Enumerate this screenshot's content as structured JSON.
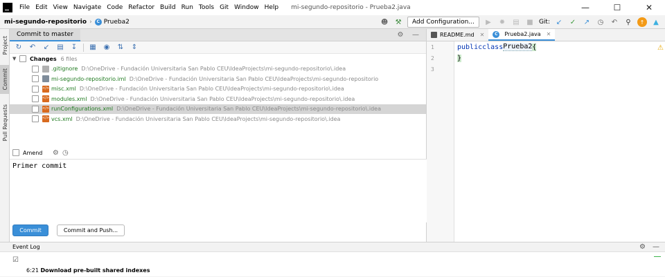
{
  "menu": [
    "File",
    "Edit",
    "View",
    "Navigate",
    "Code",
    "Refactor",
    "Build",
    "Run",
    "Tools",
    "Git",
    "Window",
    "Help"
  ],
  "window_title": "mi-segundo-repositorio - Prueba2.java",
  "window_controls": [
    "—",
    "☐",
    "✕"
  ],
  "navbar": {
    "project": "mi-segundo-repositorio",
    "file": "Prueba2",
    "add_config": "Add Configuration...",
    "git_label": "Git:"
  },
  "left_stripe": [
    "Project",
    "Commit",
    "Pull Requests"
  ],
  "commit_panel": {
    "tab": "Commit to master",
    "changes_label": "Changes",
    "changes_count": "6 files",
    "files": [
      {
        "name": ".gitignore",
        "path": "D:\\OneDrive - Fundación Universitaria San Pablo CEU\\IdeaProjects\\mi-segundo-repositorio\\.idea",
        "type": "git",
        "selected": false
      },
      {
        "name": "mi-segundo-repositorio.iml",
        "path": "D:\\OneDrive - Fundación Universitaria San Pablo CEU\\IdeaProjects\\mi-segundo-repositorio",
        "type": "iml",
        "selected": false
      },
      {
        "name": "misc.xml",
        "path": "D:\\OneDrive - Fundación Universitaria San Pablo CEU\\IdeaProjects\\mi-segundo-repositorio\\.idea",
        "type": "xml",
        "selected": false
      },
      {
        "name": "modules.xml",
        "path": "D:\\OneDrive - Fundación Universitaria San Pablo CEU\\IdeaProjects\\mi-segundo-repositorio\\.idea",
        "type": "xml",
        "selected": false
      },
      {
        "name": "runConfigurations.xml",
        "path": "D:\\OneDrive - Fundación Universitaria San Pablo CEU\\IdeaProjects\\mi-segundo-repositorio\\.idea",
        "type": "xml",
        "selected": true
      },
      {
        "name": "vcs.xml",
        "path": "D:\\OneDrive - Fundación Universitaria San Pablo CEU\\IdeaProjects\\mi-segundo-repositorio\\.idea",
        "type": "xml",
        "selected": false
      }
    ],
    "amend_label": "Amend",
    "message": "Primer commit",
    "commit_button": "Commit",
    "commit_push_button": "Commit and Push..."
  },
  "editor": {
    "tabs": [
      {
        "label": "README.md",
        "active": false
      },
      {
        "label": "Prueba2.java",
        "active": true
      }
    ],
    "line_numbers": [
      "1",
      "2",
      "3"
    ],
    "code": {
      "kw1": "public",
      "kw2": "class",
      "classname": "Prueba2",
      "open": "{",
      "close": "}"
    }
  },
  "event_log": {
    "title": "Event Log",
    "entry_time": "6:21",
    "entry_text": "Download pre-built shared indexes"
  },
  "colors": {
    "accent": "#3a8fd8",
    "changed_file": "#1f7a1f",
    "keyword": "#0033b3"
  }
}
